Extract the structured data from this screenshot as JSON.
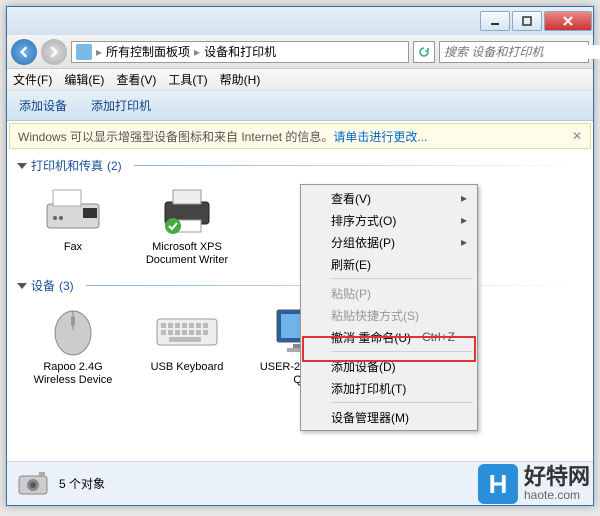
{
  "titlebar": {},
  "address": {
    "seg1": "所有控制面板项",
    "seg2": "设备和打印机"
  },
  "search": {
    "placeholder": "搜索 设备和打印机"
  },
  "menubar": {
    "file": "文件(F)",
    "edit": "编辑(E)",
    "view": "查看(V)",
    "tools": "工具(T)",
    "help": "帮助(H)"
  },
  "toolbar": {
    "add_device": "添加设备",
    "add_printer": "添加打印机"
  },
  "infobar": {
    "text": "Windows 可以显示增强型设备图标和来自 Internet 的信息。",
    "link": "请单击进行更改..."
  },
  "groups": {
    "printers": {
      "title": "打印机和传真",
      "count": "(2)"
    },
    "devices": {
      "title": "设备",
      "count": "(3)"
    }
  },
  "items": {
    "fax": "Fax",
    "xps": "Microsoft XPS Document Writer",
    "mouse": "Rapoo 2.4G Wireless Device",
    "kbd": "USB Keyboard",
    "pc": "USER-20160116 QT"
  },
  "status": {
    "count": "5 个对象"
  },
  "contextmenu": {
    "view": "查看(V)",
    "sort": "排序方式(O)",
    "group": "分组依据(P)",
    "refresh": "刷新(E)",
    "paste": "粘贴(P)",
    "paste_shortcut": "粘贴快捷方式(S)",
    "undo": "撤消 重命名(U)",
    "undo_key": "Ctrl+Z",
    "add_device": "添加设备(D)",
    "add_printer": "添加打印机(T)",
    "devmgr": "设备管理器(M)"
  },
  "watermark": {
    "brand": "好特网",
    "url": "haote.com",
    "logo": "H"
  }
}
